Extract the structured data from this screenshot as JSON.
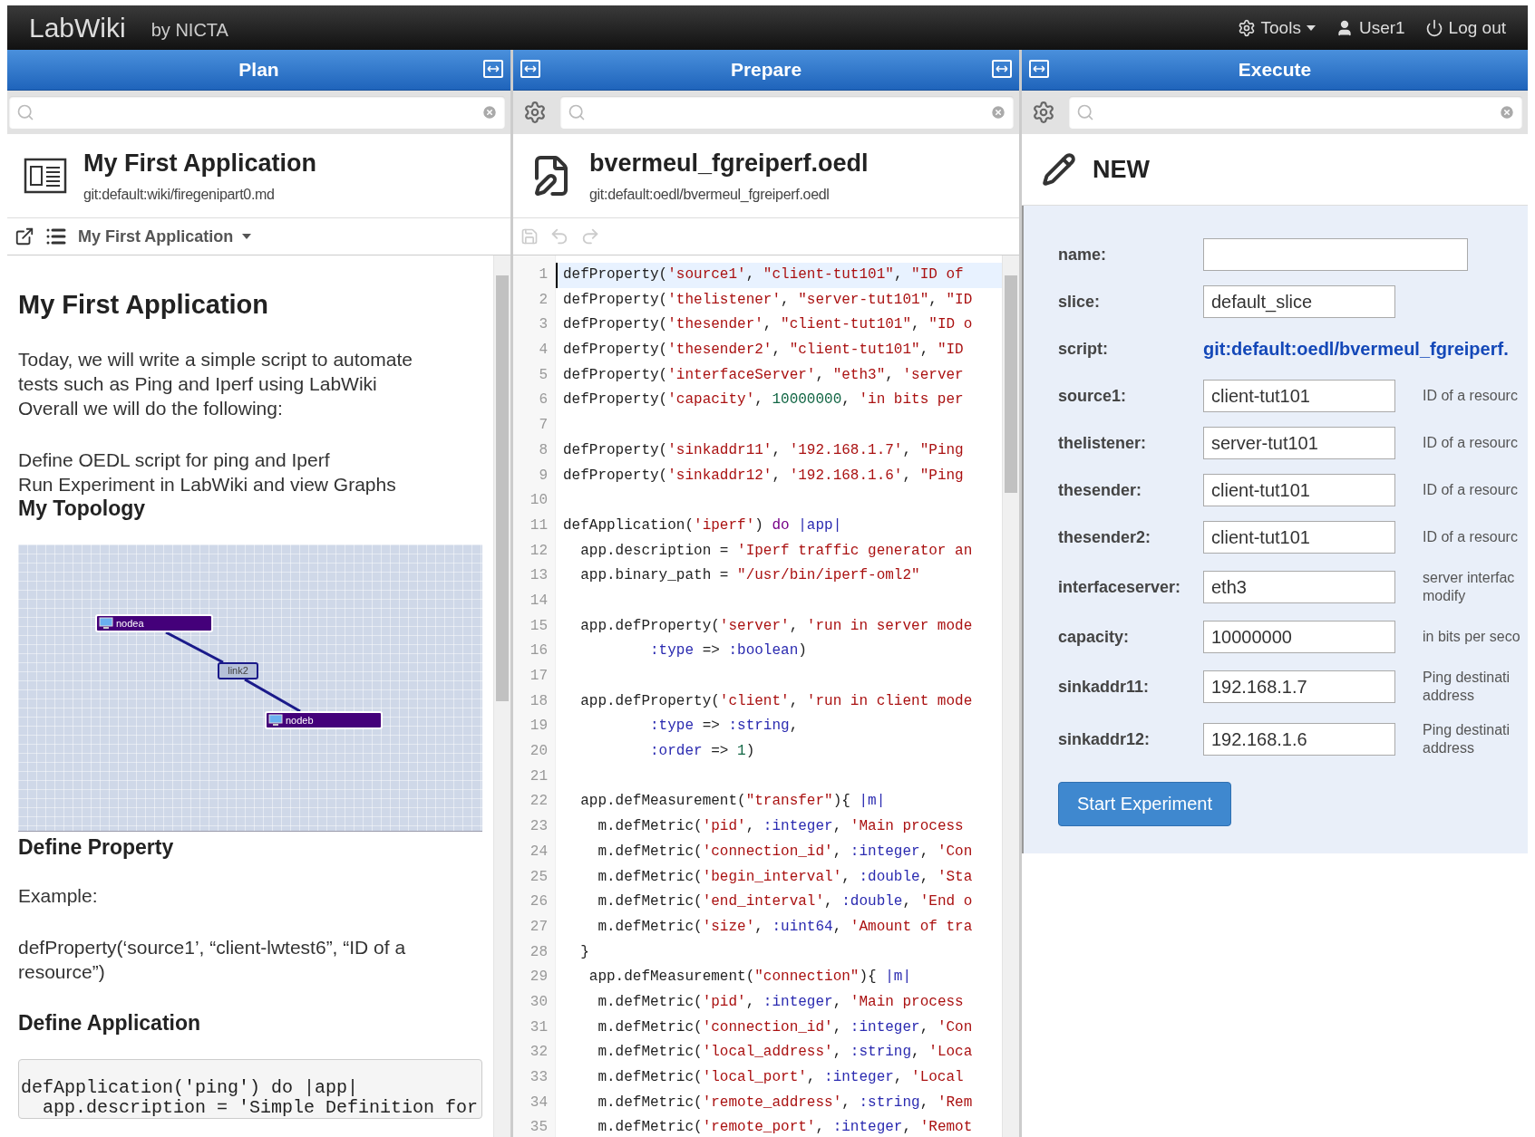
{
  "app": {
    "title": "LabWiki",
    "subtitle": "by NICTA"
  },
  "top_menu": [
    {
      "kind": "tools",
      "label": "Tools"
    },
    {
      "kind": "user",
      "label": "User1"
    },
    {
      "kind": "logout",
      "label": "Log out"
    }
  ],
  "plan": {
    "header": "Plan",
    "document": {
      "title": "My First Application",
      "path": "git:default:wiki/firegenipart0.md"
    },
    "selector": "My First Application",
    "content": [
      {
        "kind": "title",
        "text": "My First Application"
      },
      {
        "kind": "paragraph",
        "text": "Today, we will write a simple script to automate tests such as Ping and Iperf using LabWiki Overall we will do the following:"
      },
      {
        "kind": "line",
        "text": "Define OEDL script for ping and Iperf"
      },
      {
        "kind": "line",
        "text": "Run Experiment in LabWiki and view Graphs"
      },
      {
        "kind": "heading",
        "text": "My Topology"
      },
      {
        "kind": "topology",
        "nodes": [
          "nodea",
          "nodeb"
        ],
        "link": "link2"
      },
      {
        "kind": "heading",
        "text": "Define Property"
      },
      {
        "kind": "paragraph",
        "text": "Example:"
      },
      {
        "kind": "paragraph",
        "text": "defProperty(‘source1’, “client-lwtest6”, “ID of a resource”)"
      },
      {
        "kind": "heading",
        "text": "Define Application"
      },
      {
        "kind": "code",
        "lines": [
          "defApplication('ping') do |app|",
          "  app.description = 'Simple Definition for"
        ]
      }
    ]
  },
  "prepare": {
    "header": "Prepare",
    "document": {
      "title": "bvermeul_fgreiperf.oedl",
      "path": "git:default:oedl/bvermeul_fgreiperf.oedl"
    },
    "code": [
      {
        "n": "1",
        "text": "defProperty('source1', \"client-tut101\", \"ID of",
        "selected": true
      },
      {
        "n": "2",
        "text": "defProperty('thelistener', \"server-tut101\", \"ID",
        "selected": false
      },
      {
        "n": "3",
        "text": "defProperty('thesender', \"client-tut101\", \"ID o",
        "selected": false
      },
      {
        "n": "4",
        "text": "defProperty('thesender2', \"client-tut101\", \"ID",
        "selected": false
      },
      {
        "n": "5",
        "text": "defProperty('interfaceServer', \"eth3\", 'server",
        "selected": false
      },
      {
        "n": "6",
        "text": "defProperty('capacity', 10000000, 'in bits per",
        "selected": false
      },
      {
        "n": "7",
        "selected": false
      },
      {
        "n": "8",
        "text": "defProperty('sinkaddr11', '192.168.1.7', \"Ping",
        "selected": false
      },
      {
        "n": "9",
        "text": "defProperty('sinkaddr12', '192.168.1.6', \"Ping",
        "selected": false
      },
      {
        "n": "10",
        "selected": false
      },
      {
        "n": "11",
        "text": "defApplication('iperf') do |app|",
        "selected": false
      },
      {
        "n": "12",
        "text": "  app.description = 'Iperf traffic generator an",
        "selected": false
      },
      {
        "n": "13",
        "text": "  app.binary_path = \"/usr/bin/iperf-oml2\"",
        "selected": false
      },
      {
        "n": "14",
        "selected": false
      },
      {
        "n": "15",
        "text": "  app.defProperty('server', 'run in server mode",
        "selected": false
      },
      {
        "n": "16",
        "text": "          :type => :boolean)",
        "selected": false
      },
      {
        "n": "17",
        "selected": false
      },
      {
        "n": "18",
        "text": "  app.defProperty('client', 'run in client mode",
        "selected": false
      },
      {
        "n": "19",
        "text": "          :type => :string,",
        "selected": false
      },
      {
        "n": "20",
        "text": "          :order => 1)",
        "selected": false
      },
      {
        "n": "21",
        "selected": false
      },
      {
        "n": "22",
        "text": "  app.defMeasurement(\"transfer\"){ |m|",
        "selected": false
      },
      {
        "n": "23",
        "text": "    m.defMetric('pid', :integer, 'Main process",
        "selected": false
      },
      {
        "n": "24",
        "text": "    m.defMetric('connection_id', :integer, 'Con",
        "selected": false
      },
      {
        "n": "25",
        "text": "    m.defMetric('begin_interval', :double, 'Sta",
        "selected": false
      },
      {
        "n": "26",
        "text": "    m.defMetric('end_interval', :double, 'End o",
        "selected": false
      },
      {
        "n": "27",
        "text": "    m.defMetric('size', :uint64, 'Amount of tra",
        "selected": false
      },
      {
        "n": "28",
        "text": "  }",
        "selected": false
      },
      {
        "n": "29",
        "text": "   app.defMeasurement(\"connection\"){ |m|",
        "selected": false
      },
      {
        "n": "30",
        "text": "    m.defMetric('pid', :integer, 'Main process",
        "selected": false
      },
      {
        "n": "31",
        "text": "    m.defMetric('connection_id', :integer, 'Con",
        "selected": false
      },
      {
        "n": "32",
        "text": "    m.defMetric('local_address', :string, 'Loca",
        "selected": false
      },
      {
        "n": "33",
        "text": "    m.defMetric('local_port', :integer, 'Local",
        "selected": false
      },
      {
        "n": "34",
        "text": "    m.defMetric('remote_address', :string, 'Rem",
        "selected": false
      },
      {
        "n": "35",
        "text": "    m.defMetric('remote_port', :integer, 'Remot",
        "selected": false
      }
    ]
  },
  "execute": {
    "header": "Execute",
    "document": {
      "title": "NEW"
    },
    "fields": [
      {
        "kind": "wide",
        "label": "name:"
      },
      {
        "kind": "input",
        "label": "slice:",
        "value": "default_slice"
      },
      {
        "kind": "link",
        "label": "script:",
        "value": "git:default:oedl/bvermeul_fgreiperf."
      },
      {
        "kind": "input",
        "label": "source1:",
        "value": "client-tut101",
        "hint": "ID of a resourc"
      },
      {
        "kind": "input",
        "label": "thelistener:",
        "value": "server-tut101",
        "hint": "ID of a resourc"
      },
      {
        "kind": "input",
        "label": "thesender:",
        "value": "client-tut101",
        "hint": "ID of a resourc"
      },
      {
        "kind": "input",
        "label": "thesender2:",
        "value": "client-tut101",
        "hint": "ID of a resourc"
      },
      {
        "kind": "input",
        "label": "interfaceserver:",
        "value": "eth3",
        "hint": "server interfac\nmodify"
      },
      {
        "kind": "input",
        "label": "capacity:",
        "value": "10000000",
        "hint": "in bits per seco"
      },
      {
        "kind": "input",
        "label": "sinkaddr11:",
        "value": "192.168.1.7",
        "hint": "Ping destinati\naddress"
      },
      {
        "kind": "input",
        "label": "sinkaddr12:",
        "value": "192.168.1.6",
        "hint": "Ping destinati\naddress"
      }
    ],
    "button": "Start Experiment"
  }
}
